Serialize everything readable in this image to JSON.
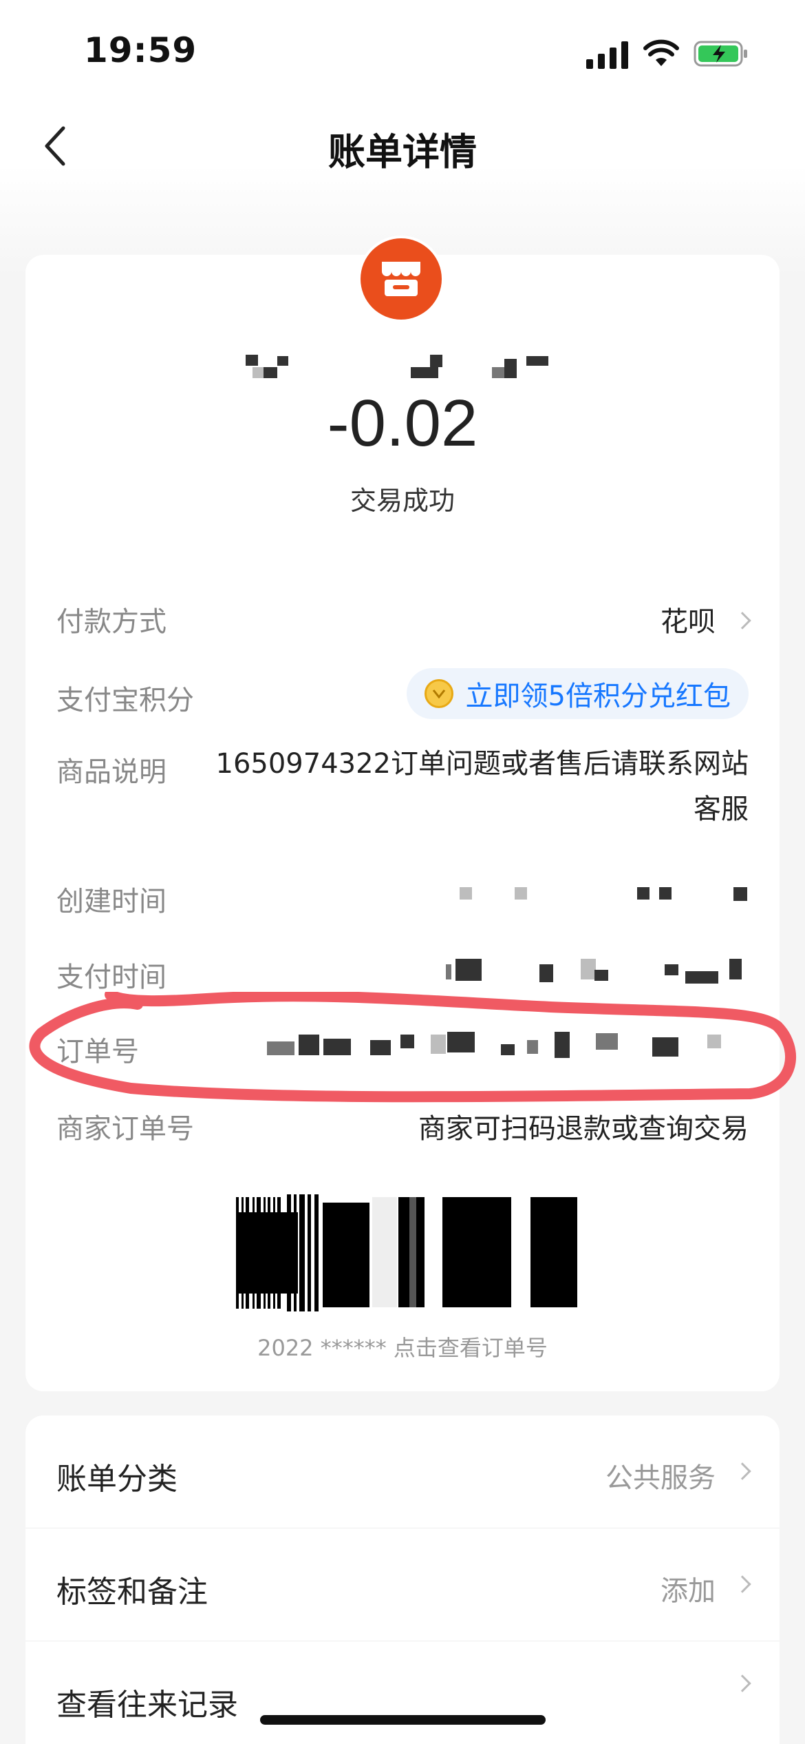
{
  "status_bar": {
    "time": "19:59"
  },
  "nav": {
    "title": "账单详情"
  },
  "transaction": {
    "amount": "-0.02",
    "status": "交易成功"
  },
  "details": {
    "payment_method_label": "付款方式",
    "payment_method_value": "花呗",
    "points_label": "支付宝积分",
    "points_promo": "立即领5倍积分兑红包",
    "desc_label": "商品说明",
    "desc_value": "1650974322订单问题或者售后请联系网站客服",
    "created_label": "创建时间",
    "paid_label": "支付时间",
    "order_no_label": "订单号",
    "merchant_order_label": "商家订单号",
    "merchant_order_value": "商家可扫码退款或查询交易"
  },
  "barcode": {
    "caption": "2022 ****** 点击查看订单号"
  },
  "list": [
    {
      "label": "账单分类",
      "value": "公共服务"
    },
    {
      "label": "标签和备注",
      "value": "添加"
    },
    {
      "label": "查看往来记录",
      "value": ""
    }
  ],
  "colors": {
    "merchant_icon": "#ea4e1c",
    "link_blue": "#1677ff",
    "annotation_red": "#f05a63"
  },
  "icons": [
    "back-arrow-icon",
    "shop-icon",
    "chevron-right-icon",
    "coin-icon",
    "signal-icon",
    "wifi-icon",
    "battery-icon"
  ]
}
